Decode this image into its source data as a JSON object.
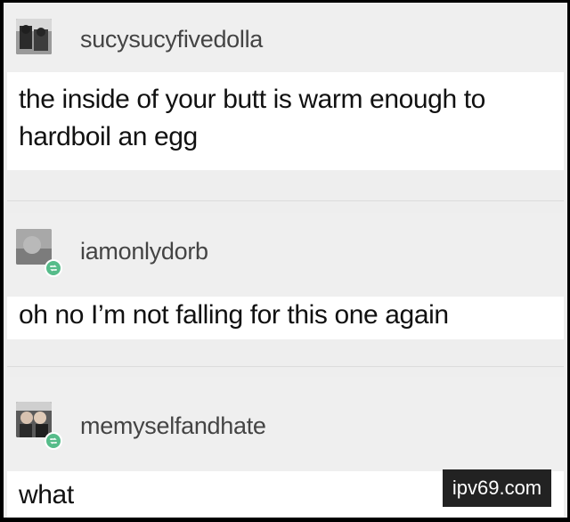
{
  "posts": [
    {
      "username": "sucysucyfivedolla",
      "text_lines": [
        "the inside of your butt is warm enough to",
        "hardboil an egg"
      ],
      "avatar_icon": "user-avatar-icon",
      "reblog": false
    },
    {
      "username": "iamonlydorb",
      "text_lines": [
        "oh no I’m not falling for this one again"
      ],
      "avatar_icon": "user-avatar-icon",
      "reblog": true
    },
    {
      "username": "memyselfandhate",
      "text_lines": [
        "what"
      ],
      "avatar_icon": "user-avatar-icon",
      "reblog": true
    }
  ],
  "reblog_icon": "reblog-icon",
  "watermark": "ipv69.com",
  "colors": {
    "background": "#eeeeee",
    "post_body": "#ffffff",
    "username": "#444444",
    "text": "#111111",
    "reblog_badge": "#56bc8a",
    "watermark_bg": "#222222"
  }
}
